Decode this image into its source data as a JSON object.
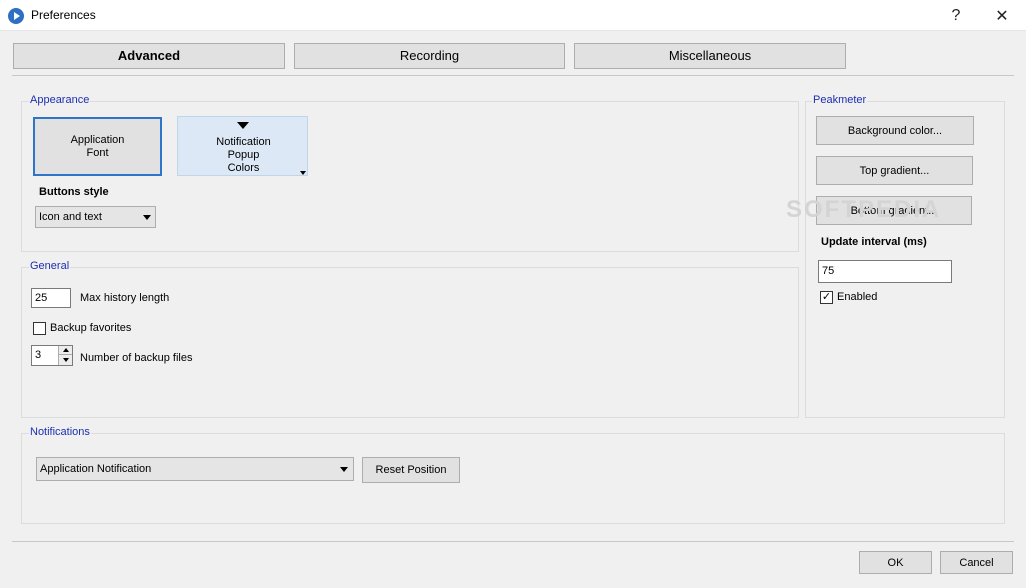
{
  "window": {
    "title": "Preferences",
    "help_label": "?",
    "close_label": "✕"
  },
  "tabs": [
    {
      "label": "Advanced"
    },
    {
      "label": "Recording"
    },
    {
      "label": "Miscellaneous"
    }
  ],
  "appearance": {
    "group_label": "Appearance",
    "app_font_line1": "Application",
    "app_font_line2": "Font",
    "notif_line1": "Notification",
    "notif_line2": "Popup",
    "notif_line3": "Colors",
    "buttons_style_label": "Buttons style",
    "buttons_style_value": "Icon and text"
  },
  "general": {
    "group_label": "General",
    "history_value": "25",
    "history_label": "Max history length",
    "backup_fav_label": "Backup favorites",
    "backup_fav_checked": false,
    "backup_files_value": "3",
    "backup_files_label": "Number of backup files"
  },
  "notifications": {
    "group_label": "Notifications",
    "combo_value": "Application Notification",
    "reset_label": "Reset Position"
  },
  "peakmeter": {
    "group_label": "Peakmeter",
    "bg_color_label": "Background color...",
    "top_gradient_label": "Top gradient...",
    "bottom_gradient_label": "Bottom gradient...",
    "update_interval_label": "Update interval (ms)",
    "update_interval_value": "75",
    "enabled_label": "Enabled",
    "enabled_checked": true
  },
  "footer": {
    "ok_label": "OK",
    "cancel_label": "Cancel"
  },
  "watermark": "SOFTPEDIA",
  "colors": {
    "accent": "#2e74c9",
    "group_label": "#1c2fb0",
    "dialog_bg": "#f0f0f0"
  }
}
